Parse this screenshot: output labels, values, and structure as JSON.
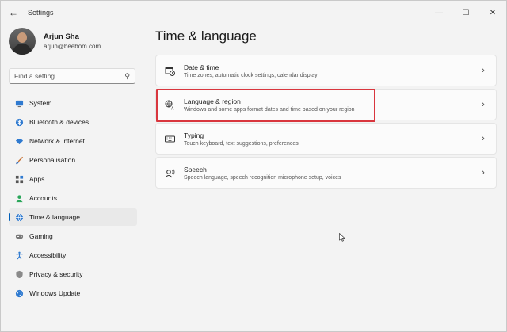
{
  "window": {
    "title": "Settings",
    "controls": {
      "minimize": "—",
      "maximize": "☐",
      "close": "✕"
    }
  },
  "profile": {
    "name": "Arjun Sha",
    "email": "arjun@beebom.com"
  },
  "search": {
    "placeholder": "Find a setting"
  },
  "sidebar": {
    "items": [
      {
        "label": "System",
        "icon": "monitor-icon",
        "active": false
      },
      {
        "label": "Bluetooth & devices",
        "icon": "bluetooth-icon",
        "active": false
      },
      {
        "label": "Network & internet",
        "icon": "wifi-icon",
        "active": false
      },
      {
        "label": "Personalisation",
        "icon": "brush-icon",
        "active": false
      },
      {
        "label": "Apps",
        "icon": "apps-icon",
        "active": false
      },
      {
        "label": "Accounts",
        "icon": "person-icon",
        "active": false
      },
      {
        "label": "Time & language",
        "icon": "globe-clock-icon",
        "active": true
      },
      {
        "label": "Gaming",
        "icon": "gamepad-icon",
        "active": false
      },
      {
        "label": "Accessibility",
        "icon": "accessibility-icon",
        "active": false
      },
      {
        "label": "Privacy & security",
        "icon": "shield-icon",
        "active": false
      },
      {
        "label": "Windows Update",
        "icon": "update-icon",
        "active": false
      }
    ]
  },
  "main": {
    "title": "Time & language",
    "cards": [
      {
        "title": "Date & time",
        "desc": "Time zones, automatic clock settings, calendar display",
        "icon": "calendar-clock-icon"
      },
      {
        "title": "Language & region",
        "desc": "Windows and some apps format dates and time based on your region",
        "icon": "language-icon"
      },
      {
        "title": "Typing",
        "desc": "Touch keyboard, text suggestions, preferences",
        "icon": "keyboard-icon"
      },
      {
        "title": "Speech",
        "desc": "Speech language, speech recognition microphone setup, voices",
        "icon": "speech-icon"
      }
    ]
  },
  "colors": {
    "accent": "#005fb8",
    "highlight": "#d9363e",
    "background": "#f3f3f3",
    "card": "#fbfbfb"
  }
}
